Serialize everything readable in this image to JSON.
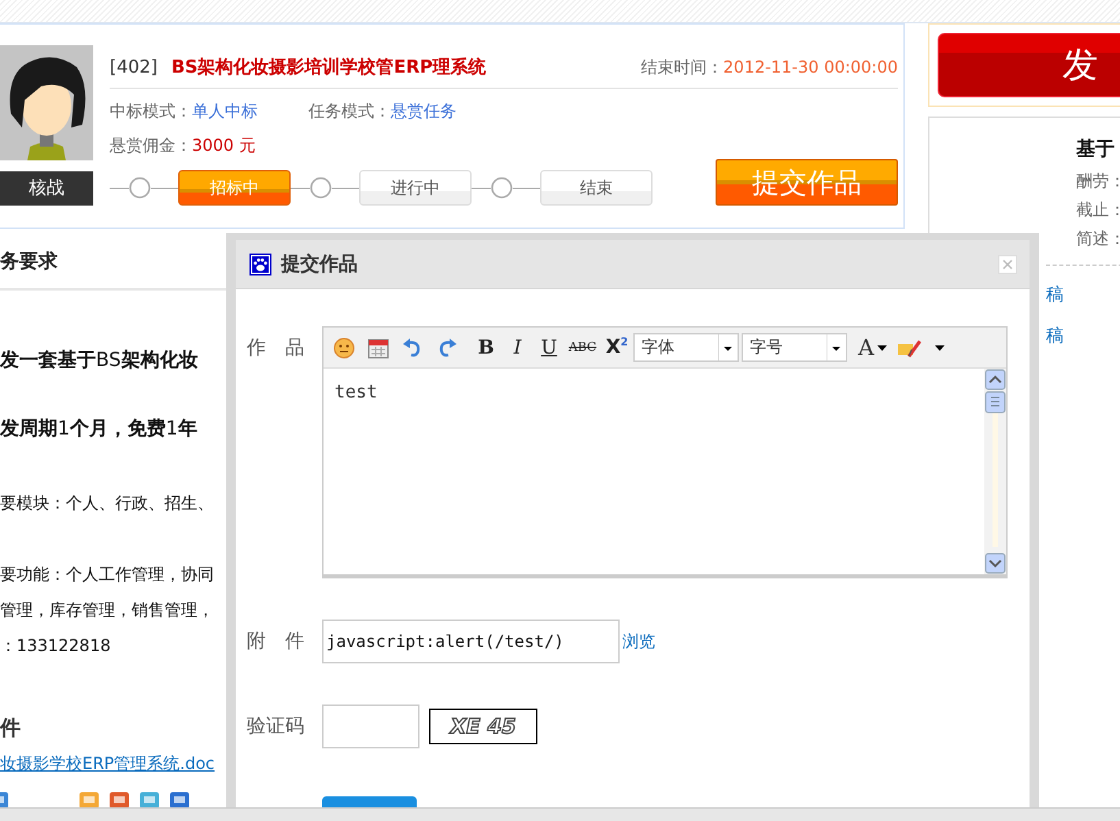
{
  "task": {
    "id": "[402]",
    "title": "BS架构化妆摄影培训学校管ERP理系统",
    "end_time_label": "结束时间：",
    "end_time": "2012-11-30 00:00:00",
    "fields": [
      {
        "label": "中标模式：",
        "value": "单人中标",
        "kind": "mode"
      },
      {
        "label": "任务模式：",
        "value": "悬赏任务",
        "kind": "mode"
      },
      {
        "label": "悬赏佣金：",
        "value": "3000 元",
        "kind": "money"
      }
    ],
    "user": "核战",
    "steps": [
      {
        "label": "招标中",
        "selected": true
      },
      {
        "label": "进行中",
        "selected": false
      },
      {
        "label": "结束",
        "selected": false
      }
    ],
    "submit_button": "提交作品"
  },
  "sidebar": {
    "publish_button": "发",
    "card": {
      "title": "基于",
      "fields": [
        "酬劳：",
        "截止：",
        "简述："
      ]
    },
    "links": [
      "稿",
      "稿"
    ]
  },
  "requirements": {
    "heading": "务要求",
    "paragraphs": [
      {
        "kind": "lead",
        "text": "**发一套基于**BS**架构化妆**"
      },
      {
        "kind": "lead",
        "text": "**发周期**1**个月，免费**1**年**"
      },
      {
        "kind": "body",
        "text": "要模块：个人、行政、招生、"
      },
      {
        "kind": "gap",
        "text": "要功能：个人工作管理，协同"
      },
      {
        "kind": "body",
        "text": "管理，库存管理，销售管理，"
      },
      {
        "kind": "body",
        "text": "：133122818"
      }
    ]
  },
  "attachments": {
    "heading": "件",
    "file": "妆摄影学校ERP管理系统.doc"
  },
  "dialog": {
    "title": "提交作品",
    "work_label": "作　品",
    "attachment_label": "附　件",
    "captcha_label": "验证码",
    "editor": {
      "format_buttons": [
        {
          "kind": "bold",
          "label": "B"
        },
        {
          "kind": "italic",
          "label": "I"
        },
        {
          "kind": "underline",
          "label": "U"
        },
        {
          "kind": "strike",
          "label": "ABC"
        },
        {
          "kind": "super",
          "label": "X$^{2}$"
        }
      ],
      "font_select": "字体",
      "size_select": "字号",
      "font_color": "A",
      "content": "test"
    },
    "attachment_value": "javascript:alert(/test/)",
    "browse": "浏览",
    "captcha": "XE 45"
  }
}
